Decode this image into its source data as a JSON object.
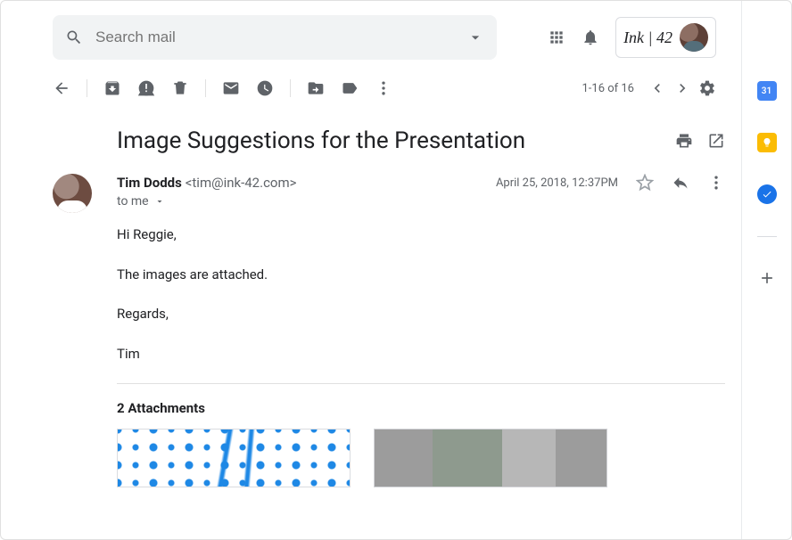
{
  "header": {
    "search_placeholder": "Search mail",
    "brand_label": "Ink | 42"
  },
  "toolbar": {
    "page_count": "1-16 of 16"
  },
  "message": {
    "subject": "Image Suggestions for the Presentation",
    "sender_name": "Tim Dodds",
    "sender_email": "<tim@ink-42.com>",
    "to_label": "to me",
    "date": "April 25, 2018, 12:37PM",
    "body": {
      "greeting": "Hi Reggie,",
      "line1": "The images are attached.",
      "signoff": "Regards,",
      "signature": "Tim"
    },
    "attachments_label": "2 Attachments"
  },
  "sidepanel": {
    "calendar_day": "31"
  }
}
